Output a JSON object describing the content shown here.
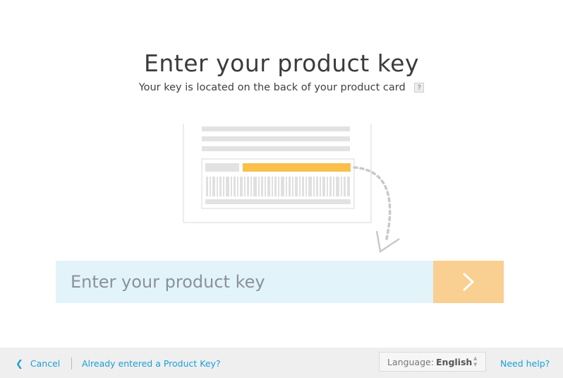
{
  "header": {
    "title": "Enter your product key",
    "subtitle": "Your key is located on the back of your product card",
    "help_glyph": "?"
  },
  "illustration": {
    "icon": "product-card-illustration",
    "highlight_color": "#f9c14a"
  },
  "key_entry": {
    "placeholder": "Enter your product key",
    "value": "",
    "submit_icon": "chevron-right-icon"
  },
  "footer": {
    "cancel_label": "Cancel",
    "already_entered_label": "Already entered a Product Key?",
    "language_label": "Language:",
    "language_value": "English",
    "need_help_label": "Need help?"
  },
  "colors": {
    "accent_link": "#1a9fd8",
    "input_bg": "#e2f3fa",
    "button_bg": "#f9cf92"
  }
}
